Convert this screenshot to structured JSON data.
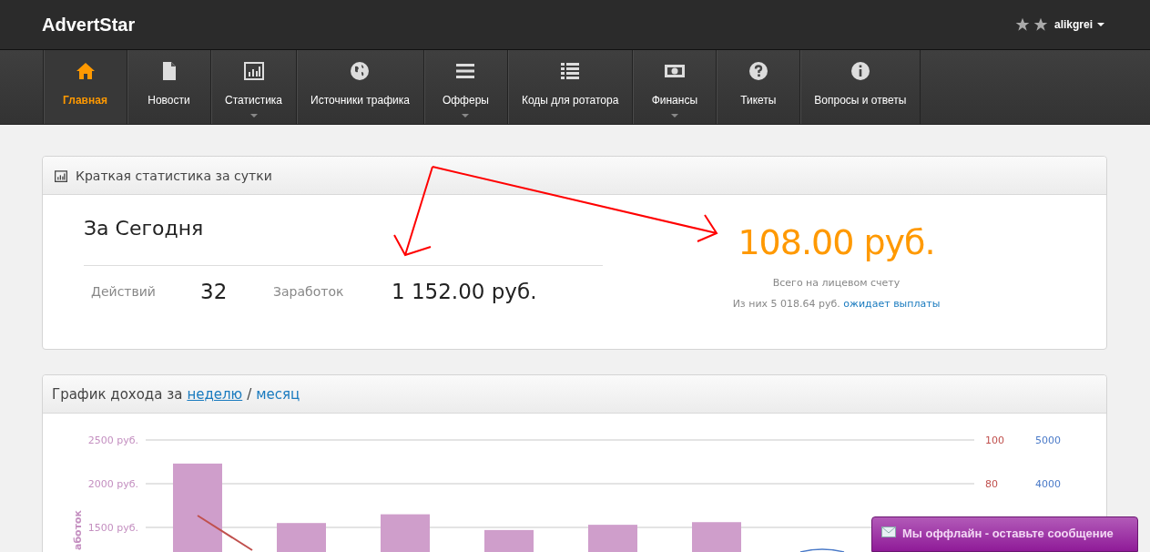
{
  "brand": "AdvertStar",
  "user": {
    "name": "alikgrei"
  },
  "nav": [
    {
      "label": "Главная",
      "kind": "home",
      "selected": true,
      "has_menu": false
    },
    {
      "label": "Новости",
      "kind": "document",
      "selected": false,
      "has_menu": false
    },
    {
      "label": "Статистика",
      "kind": "chart",
      "selected": false,
      "has_menu": true
    },
    {
      "label": "Источники трафика",
      "kind": "globe",
      "selected": false,
      "has_menu": false
    },
    {
      "label": "Офферы",
      "kind": "bars",
      "selected": false,
      "has_menu": true
    },
    {
      "label": "Коды для ротатора",
      "kind": "list",
      "selected": false,
      "has_menu": false
    },
    {
      "label": "Финансы",
      "kind": "money",
      "selected": false,
      "has_menu": true
    },
    {
      "label": "Тикеты",
      "kind": "question",
      "selected": false,
      "has_menu": false
    },
    {
      "label": "Вопросы и ответы",
      "kind": "info",
      "selected": false,
      "has_menu": false
    }
  ],
  "stats_panel": {
    "title": "Краткая статистика за сутки",
    "heading": "За Сегодня",
    "metrics": [
      {
        "label": "Действий",
        "value": "32"
      },
      {
        "label": "Заработок",
        "value": "1 152.00 руб."
      }
    ],
    "balance": "108.00 руб.",
    "balance_caption": "Всего на лицевом счету",
    "pending_text": "Из них 5 018.64 руб.",
    "pending_link": "ожидает выплаты"
  },
  "chart_panel": {
    "title": "График дохода за",
    "period_links": [
      {
        "label": "неделю",
        "selected": true
      },
      {
        "label": "месяц",
        "selected": false
      }
    ],
    "separator": "/",
    "right_axis_1": [
      "100",
      "80"
    ],
    "right_axis_2": [
      "5000",
      "4000"
    ],
    "chart_data": {
      "type": "bar",
      "ylabel": "аботок",
      "series": [
        {
          "color": "#cf9ecb",
          "values": [
            2230,
            1550,
            1650,
            1470,
            1530,
            1560
          ]
        }
      ],
      "ylim": [
        0,
        2500
      ],
      "yticks": [
        {
          "value": 2500,
          "label": "2500 руб."
        },
        {
          "value": 2000,
          "label": "2000 руб."
        },
        {
          "value": 1500,
          "label": "1500 руб."
        }
      ]
    }
  },
  "chat": {
    "label": "Мы оффлайн - оставьте сообщение"
  }
}
